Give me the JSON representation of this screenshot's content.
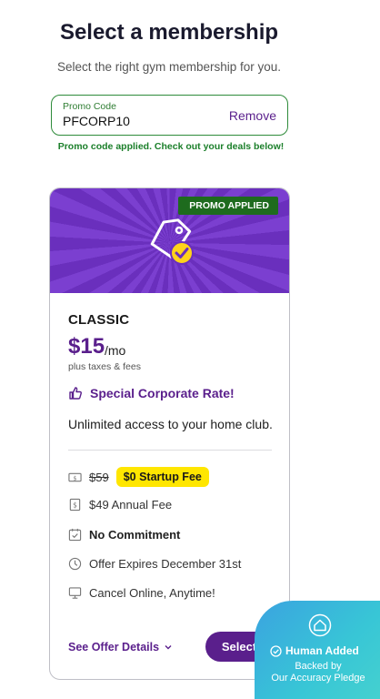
{
  "header": {
    "title": "Select a membership",
    "subtitle": "Select the right gym membership for you."
  },
  "promo": {
    "label": "Promo Code",
    "value": "PFCORP10",
    "remove_label": "Remove",
    "message": "Promo code applied. Check out your deals below!"
  },
  "plan": {
    "badge": "PROMO APPLIED",
    "name": "CLASSIC",
    "price": "$15",
    "price_unit": "/mo",
    "price_note": "plus taxes & fees",
    "rate_label": "Special Corporate Rate!",
    "description": "Unlimited access to your home club.",
    "features": {
      "startup_old": "$59",
      "startup_badge": "$0 Startup Fee",
      "annual_fee": "$49 Annual Fee",
      "commitment": "No Commitment",
      "expires": "Offer Expires December 31st",
      "cancel": "Cancel Online, Anytime!"
    },
    "details_link": "See Offer Details",
    "select_label": "Select"
  },
  "pledge": {
    "title": "Human Added",
    "line1": "Backed by",
    "line2": "Our Accuracy Pledge"
  },
  "colors": {
    "brand_purple": "#5a1f8c",
    "promo_green": "#1e6b1e",
    "fee_yellow": "#ffe600",
    "pledge_teal": "#38c6d6"
  }
}
